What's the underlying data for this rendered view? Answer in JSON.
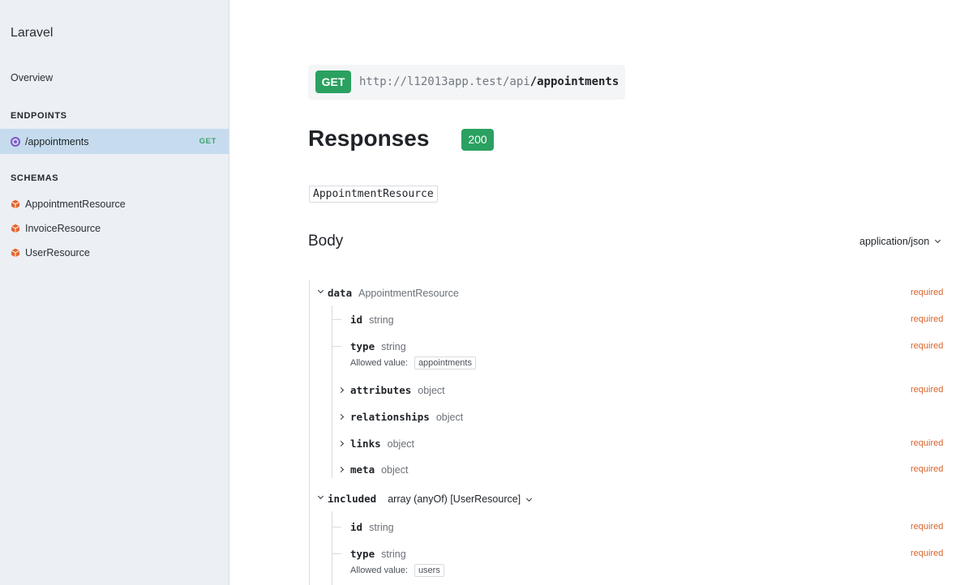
{
  "sidebar": {
    "brand": "Laravel",
    "overview_label": "Overview",
    "endpoints_heading": "ENDPOINTS",
    "endpoints": [
      {
        "path": "/appointments",
        "method": "GET"
      }
    ],
    "schemas_heading": "SCHEMAS",
    "schemas": [
      {
        "label": "AppointmentResource"
      },
      {
        "label": "InvoiceResource"
      },
      {
        "label": "UserResource"
      }
    ]
  },
  "request": {
    "method": "GET",
    "base_url": "http://l12013app.test/api",
    "path": "/appointments"
  },
  "responses": {
    "title": "Responses",
    "status_code": "200",
    "schema_name": "AppointmentResource"
  },
  "body": {
    "title": "Body",
    "content_type": "application/json",
    "required_label": "required",
    "allowed_value_label": "Allowed value:",
    "data": {
      "name": "data",
      "type": "AppointmentResource"
    },
    "data_fields": [
      {
        "name": "id",
        "type": "string",
        "required": "required"
      },
      {
        "name": "type",
        "type": "string",
        "required": "required",
        "allowed": "appointments"
      },
      {
        "name": "attributes",
        "type": "object",
        "required": "required"
      },
      {
        "name": "relationships",
        "type": "object",
        "required": ""
      },
      {
        "name": "links",
        "type": "object",
        "required": "required"
      },
      {
        "name": "meta",
        "type": "object",
        "required": "required"
      }
    ],
    "included": {
      "name": "included",
      "type": "array (anyOf) [UserResource]"
    },
    "included_fields": [
      {
        "name": "id",
        "type": "string",
        "required": "required"
      },
      {
        "name": "type",
        "type": "string",
        "required": "required",
        "allowed": "users"
      }
    ]
  },
  "colors": {
    "accent_green": "#2aa160",
    "required_orange": "#d9622b",
    "sidebar_bg": "#eceff3",
    "active_item_bg": "#c6dcee",
    "endpoint_icon": "#8454c9",
    "schema_icon": "#e5652d"
  }
}
